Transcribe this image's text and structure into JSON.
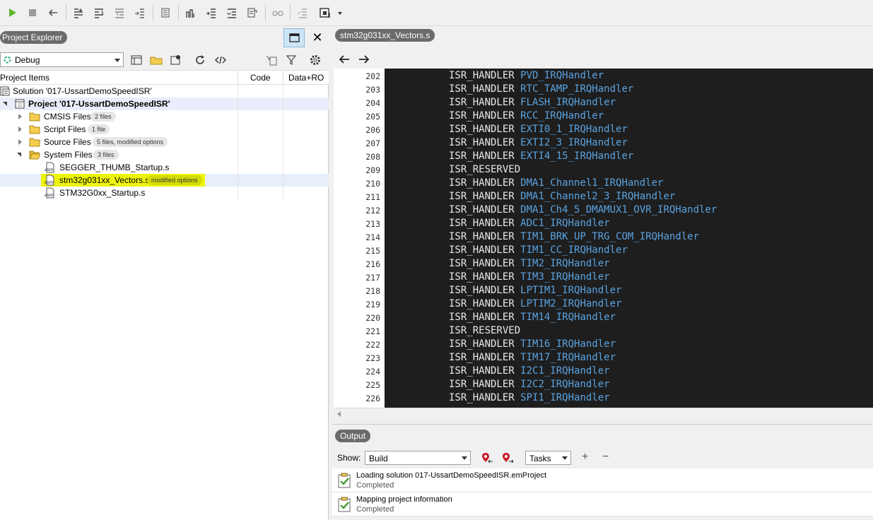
{
  "explorer": {
    "title": "Project Explorer",
    "configuration": "Debug",
    "columns": [
      "Project Items",
      "Code",
      "Data+RO"
    ],
    "tree": [
      {
        "label": "Solution '017-UssartDemoSpeedISR'",
        "icon": "solution-icon"
      },
      {
        "label": "Project '017-UssartDemoSpeedISR'",
        "icon": "project-icon",
        "bold": true,
        "expanded": true
      },
      {
        "label": "CMSIS Files",
        "icon": "folder-icon",
        "badge": "2 files",
        "expanded": false
      },
      {
        "label": "Script Files",
        "icon": "folder-icon",
        "badge": "1 file",
        "expanded": false
      },
      {
        "label": "Source Files",
        "icon": "folder-icon",
        "badge": "5 files, modified options",
        "expanded": false
      },
      {
        "label": "System Files",
        "icon": "folder-open-icon",
        "badge": "3 files",
        "expanded": true
      },
      {
        "label": "SEGGER_THUMB_Startup.s",
        "icon": "asm-file-icon"
      },
      {
        "label": "stm32g031xx_Vectors.s",
        "icon": "asm-file-icon",
        "badge": "modified options",
        "selected": true,
        "highlighted": true
      },
      {
        "label": "STM32G0xx_Startup.s",
        "icon": "asm-file-icon"
      }
    ]
  },
  "editor": {
    "tab_label": "stm32g031xx_Vectors.s",
    "lines": [
      {
        "num": "202",
        "kw": "ISR_HANDLER",
        "fn": "PVD_IRQHandler"
      },
      {
        "num": "203",
        "kw": "ISR_HANDLER",
        "fn": "RTC_TAMP_IRQHandler"
      },
      {
        "num": "204",
        "kw": "ISR_HANDLER",
        "fn": "FLASH_IRQHandler"
      },
      {
        "num": "205",
        "kw": "ISR_HANDLER",
        "fn": "RCC_IRQHandler"
      },
      {
        "num": "206",
        "kw": "ISR_HANDLER",
        "fn": "EXTI0_1_IRQHandler"
      },
      {
        "num": "207",
        "kw": "ISR_HANDLER",
        "fn": "EXTI2_3_IRQHandler"
      },
      {
        "num": "208",
        "kw": "ISR_HANDLER",
        "fn": "EXTI4_15_IRQHandler"
      },
      {
        "num": "209",
        "kw": "ISR_RESERVED",
        "fn": ""
      },
      {
        "num": "210",
        "kw": "ISR_HANDLER",
        "fn": "DMA1_Channel1_IRQHandler"
      },
      {
        "num": "211",
        "kw": "ISR_HANDLER",
        "fn": "DMA1_Channel2_3_IRQHandler"
      },
      {
        "num": "212",
        "kw": "ISR_HANDLER",
        "fn": "DMA1_Ch4_5_DMAMUX1_OVR_IRQHandler"
      },
      {
        "num": "213",
        "kw": "ISR_HANDLER",
        "fn": "ADC1_IRQHandler"
      },
      {
        "num": "214",
        "kw": "ISR_HANDLER",
        "fn": "TIM1_BRK_UP_TRG_COM_IRQHandler"
      },
      {
        "num": "215",
        "kw": "ISR_HANDLER",
        "fn": "TIM1_CC_IRQHandler"
      },
      {
        "num": "216",
        "kw": "ISR_HANDLER",
        "fn": "TIM2_IRQHandler"
      },
      {
        "num": "217",
        "kw": "ISR_HANDLER",
        "fn": "TIM3_IRQHandler"
      },
      {
        "num": "218",
        "kw": "ISR_HANDLER",
        "fn": "LPTIM1_IRQHandler"
      },
      {
        "num": "219",
        "kw": "ISR_HANDLER",
        "fn": "LPTIM2_IRQHandler"
      },
      {
        "num": "220",
        "kw": "ISR_HANDLER",
        "fn": "TIM14_IRQHandler"
      },
      {
        "num": "221",
        "kw": "ISR_RESERVED",
        "fn": ""
      },
      {
        "num": "222",
        "kw": "ISR_HANDLER",
        "fn": "TIM16_IRQHandler"
      },
      {
        "num": "223",
        "kw": "ISR_HANDLER",
        "fn": "TIM17_IRQHandler"
      },
      {
        "num": "224",
        "kw": "ISR_HANDLER",
        "fn": "I2C1_IRQHandler"
      },
      {
        "num": "225",
        "kw": "ISR_HANDLER",
        "fn": "I2C2_IRQHandler"
      },
      {
        "num": "226",
        "kw": "ISR_HANDLER",
        "fn": "SPI1_IRQHandler"
      }
    ]
  },
  "output": {
    "title": "Output",
    "show_label": "Show:",
    "show_value": "Build",
    "tasks_value": "Tasks",
    "add_symbol": "+",
    "remove_symbol": "−",
    "messages": [
      {
        "text": "Loading solution 017-UssartDemoSpeedISR.emProject",
        "status": "Completed"
      },
      {
        "text": "Mapping project information",
        "status": "Completed"
      }
    ]
  },
  "colors": {
    "editor_background": "#1e1e1e",
    "keyword": "#e8e8e8",
    "identifier": "#5aa3e0",
    "highlight": "#eef40a",
    "pill": "#6b6b6b"
  }
}
